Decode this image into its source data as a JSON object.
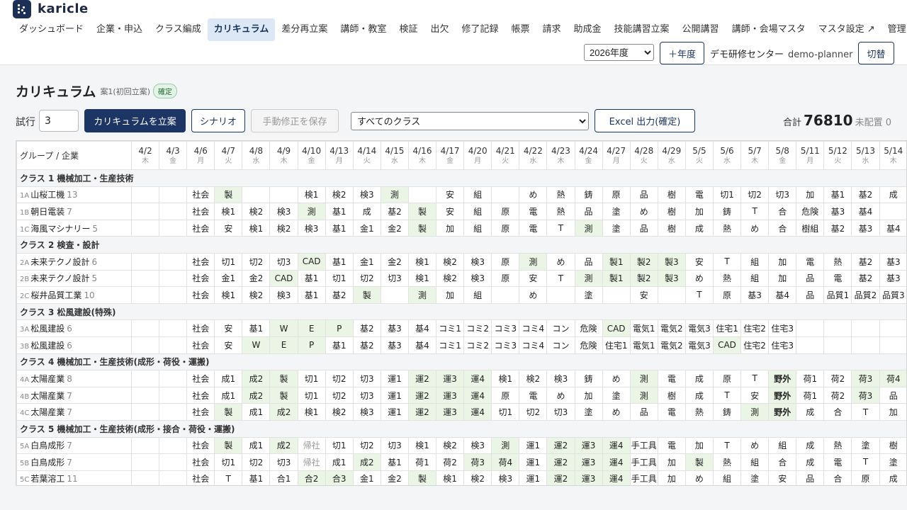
{
  "app": {
    "name": "karicle",
    "logo_icon": "karicle-logo-icon"
  },
  "nav": [
    "ダッシュボード",
    "企業・申込",
    "クラス編成",
    "カリキュラム",
    "差分再立案",
    "講師・教室",
    "検証",
    "出欠",
    "修了記録",
    "帳票",
    "請求",
    "助成金",
    "技能講習立案",
    "公開講習",
    "講師・会場マスタ",
    "マスタ設定 ↗",
    "管理"
  ],
  "nav_active": 3,
  "header": {
    "year": "2026年度",
    "add_year": "＋年度",
    "org": "デモ研修センター",
    "user": "demo-planner",
    "switch": "切替"
  },
  "page": {
    "title": "カリキュラム",
    "subtitle": "案1(初回立案)",
    "badge": "確定"
  },
  "toolbar": {
    "trial_label": "試行",
    "trial_value": "3",
    "plan": "カリキュラムを立案",
    "scenario": "シナリオ",
    "save": "手動修正を保存",
    "class_filter": "すべてのクラス",
    "excel": "Excel 出力(確定)",
    "total_label": "合計",
    "total_value": "76810",
    "unassigned": "未配置 0"
  },
  "grid": {
    "corner": "グループ / 企業",
    "dates": [
      [
        "4/2",
        "木"
      ],
      [
        "4/3",
        "金"
      ],
      [
        "4/6",
        "月"
      ],
      [
        "4/7",
        "火"
      ],
      [
        "4/8",
        "水"
      ],
      [
        "4/9",
        "木"
      ],
      [
        "4/10",
        "金"
      ],
      [
        "4/13",
        "月"
      ],
      [
        "4/14",
        "火"
      ],
      [
        "4/15",
        "水"
      ],
      [
        "4/16",
        "木"
      ],
      [
        "4/17",
        "金"
      ],
      [
        "4/20",
        "月"
      ],
      [
        "4/21",
        "火"
      ],
      [
        "4/22",
        "水"
      ],
      [
        "4/23",
        "木"
      ],
      [
        "4/24",
        "金"
      ],
      [
        "4/27",
        "月"
      ],
      [
        "4/28",
        "火"
      ],
      [
        "4/29",
        "水"
      ],
      [
        "5/5",
        "火"
      ],
      [
        "5/6",
        "水"
      ],
      [
        "5/7",
        "木"
      ],
      [
        "5/8",
        "金"
      ],
      [
        "5/11",
        "月"
      ],
      [
        "5/12",
        "火"
      ],
      [
        "5/13",
        "水"
      ],
      [
        "5/14",
        "木"
      ]
    ],
    "groups": [
      {
        "label": "クラス 1 機械加工・生産技術",
        "rows": [
          {
            "id": "1A",
            "name": "山桜工機",
            "count": "13",
            "cells": [
              "",
              "",
              "社会",
              "製*",
              "",
              "",
              "検1",
              "検2",
              "検3",
              "測*",
              "",
              "安",
              "組",
              "",
              "め",
              "熱",
              "鋳",
              "原",
              "品",
              "樹",
              "電",
              "切1",
              "切2",
              "切3",
              "加",
              "基1",
              "基2",
              "成"
            ]
          },
          {
            "id": "1B",
            "name": "朝日電装",
            "count": "7",
            "cells": [
              "",
              "",
              "社会",
              "検1",
              "検2",
              "検3",
              "測*",
              "基1",
              "成",
              "基2",
              "製*",
              "安",
              "組",
              "原",
              "電",
              "熱",
              "品",
              "塗",
              "め",
              "樹",
              "加",
              "鋳",
              "T",
              "合",
              "危険",
              "基3",
              "基4",
              ""
            ]
          },
          {
            "id": "1C",
            "name": "海風マシナリー",
            "count": "5",
            "cells": [
              "",
              "",
              "社会",
              "安",
              "検1",
              "検2",
              "検3",
              "基1",
              "金1",
              "金2",
              "製*",
              "加",
              "組",
              "原",
              "電",
              "T",
              "測*",
              "塗",
              "品",
              "樹",
              "成",
              "熱",
              "め",
              "合",
              "樹組",
              "基2",
              "基3",
              "基4"
            ]
          }
        ]
      },
      {
        "label": "クラス 2 検査・設計",
        "rows": [
          {
            "id": "2A",
            "name": "未来テクノ設計",
            "count": "6",
            "cells": [
              "",
              "",
              "社会",
              "切1",
              "切2",
              "切3",
              "CAD*",
              "基1",
              "金1",
              "金2",
              "検1",
              "検2",
              "検3",
              "原",
              "測*",
              "め",
              "品",
              "製1*",
              "製2*",
              "製3*",
              "安",
              "T",
              "組",
              "加",
              "電",
              "熱",
              "基2",
              "基3"
            ]
          },
          {
            "id": "2B",
            "name": "未来テクノ設計",
            "count": "5",
            "cells": [
              "",
              "",
              "社会",
              "金1",
              "金2",
              "CAD*",
              "基1",
              "切1",
              "切2",
              "切3",
              "検1",
              "検2",
              "検3",
              "原",
              "安",
              "T",
              "測*",
              "製1*",
              "製2*",
              "製3*",
              "め",
              "熱",
              "組",
              "加",
              "品",
              "電",
              "基2",
              "基3"
            ]
          },
          {
            "id": "2C",
            "name": "桜井品質工業",
            "count": "10",
            "cells": [
              "",
              "",
              "社会",
              "検1",
              "検2",
              "検3",
              "基1",
              "基2",
              "製*",
              "",
              "測*",
              "加",
              "組",
              "",
              "め",
              "",
              "塗",
              "",
              "安",
              "",
              "T",
              "原",
              "基3",
              "基4",
              "品",
              "品質1",
              "品質2",
              "品質3"
            ]
          }
        ]
      },
      {
        "label": "クラス 3 松風建設(特殊)",
        "rows": [
          {
            "id": "3A",
            "name": "松風建設",
            "count": "6",
            "cells": [
              "",
              "",
              "社会",
              "安",
              "基1",
              "W*",
              "E*",
              "P*",
              "基2",
              "基3",
              "基4",
              "コミ1",
              "コミ2",
              "コミ3",
              "コミ4",
              "コン",
              "危険",
              "CAD*",
              "電気1",
              "電気2",
              "電気3",
              "住宅1",
              "住宅2",
              "住宅3",
              "",
              "",
              "",
              ""
            ]
          },
          {
            "id": "3B",
            "name": "松風建設",
            "count": "6",
            "cells": [
              "",
              "",
              "社会",
              "安",
              "W*",
              "E*",
              "P*",
              "基1",
              "基2",
              "基3",
              "基4",
              "コミ1",
              "コミ2",
              "コミ3",
              "コミ4",
              "コン",
              "危険",
              "住宅1",
              "電気1",
              "電気2",
              "電気3",
              "CAD*",
              "住宅2",
              "住宅3",
              "",
              "",
              "",
              ""
            ]
          }
        ]
      },
      {
        "label": "クラス 4 機械加工・生産技術(成形・荷役・運搬)",
        "rows": [
          {
            "id": "4A",
            "name": "太陽産業",
            "count": "8",
            "cells": [
              "",
              "",
              "社会",
              "成1",
              "成2*",
              "製*",
              "切1",
              "切2",
              "切3",
              "運1",
              "運2*",
              "運3*",
              "運4*",
              "検1",
              "検2",
              "検3",
              "鋳",
              "め",
              "測*",
              "電",
              "成",
              "原",
              "T",
              "野外!",
              "荷1",
              "荷2",
              "荷3*",
              "荷4*"
            ]
          },
          {
            "id": "4B",
            "name": "太陽産業",
            "count": "7",
            "cells": [
              "",
              "",
              "社会",
              "成1",
              "成2*",
              "製*",
              "切1",
              "切2",
              "切3",
              "運1",
              "運2*",
              "運3*",
              "運4*",
              "原",
              "電",
              "め",
              "加",
              "塗",
              "測*",
              "樹",
              "成",
              "T",
              "安",
              "野外!",
              "荷1",
              "荷2",
              "荷3*",
              "品"
            ]
          },
          {
            "id": "4C",
            "name": "太陽産業",
            "count": "7",
            "cells": [
              "",
              "",
              "社会",
              "製*",
              "成1",
              "成2*",
              "検1",
              "検2",
              "検3",
              "運1",
              "運2*",
              "運3*",
              "運4*",
              "切1",
              "切2",
              "切3",
              "塗",
              "め",
              "品",
              "電",
              "熱",
              "鋳",
              "測*",
              "野外!",
              "成",
              "合",
              "T",
              "加"
            ]
          }
        ]
      },
      {
        "label": "クラス 5 機械加工・生産技術(成形・接合・荷役・運搬)",
        "rows": [
          {
            "id": "5A",
            "name": "白鳥成形",
            "count": "7",
            "cells": [
              "",
              "",
              "社会",
              "製*",
              "成1",
              "成2*",
              "帰社~",
              "切1",
              "切2",
              "切3",
              "検1",
              "検2",
              "検3",
              "測*",
              "運1",
              "運2*",
              "運3*",
              "運4*",
              "手工具",
              "電",
              "加",
              "T",
              "め",
              "組",
              "成",
              "熱",
              "塗",
              "樹"
            ]
          },
          {
            "id": "5B",
            "name": "白鳥成形",
            "count": "7",
            "cells": [
              "",
              "",
              "社会",
              "切1",
              "切2",
              "切3",
              "帰社~",
              "成1",
              "成2*",
              "基1",
              "荷1",
              "荷2",
              "荷3*",
              "荷4*",
              "運1",
              "運2*",
              "運3*",
              "運4*",
              "手工具",
              "加",
              "製*",
              "熱",
              "組",
              "合",
              "成",
              "電",
              "T",
              "塗"
            ]
          },
          {
            "id": "5C",
            "name": "若葉溶工",
            "count": "11",
            "cells": [
              "",
              "",
              "社会",
              "T",
              "基1",
              "合1",
              "合2*",
              "合3*",
              "金1",
              "金2",
              "製*",
              "検1",
              "検2",
              "検3",
              "運1",
              "運2*",
              "運3*",
              "運4*",
              "手工具",
              "加",
              "め",
              "組",
              "塗",
              "安",
              "品",
              "合",
              "原",
              "成"
            ]
          }
        ]
      }
    ]
  }
}
